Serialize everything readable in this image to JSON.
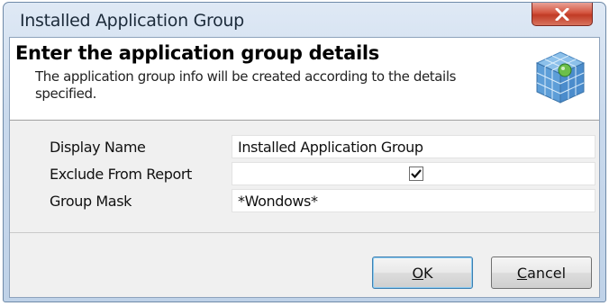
{
  "window": {
    "title": "Installed Application Group"
  },
  "header": {
    "title": "Enter the application group details",
    "description": "The application group info will be created according to the details specified."
  },
  "form": {
    "rows": [
      {
        "label": "Display Name",
        "value": "Installed Application Group"
      },
      {
        "label": "Exclude From Report",
        "checked": true
      },
      {
        "label": "Group Mask",
        "value": "*Wondows*"
      }
    ]
  },
  "buttons": {
    "ok": {
      "mnemonic": "O",
      "rest": "K"
    },
    "cancel": {
      "mnemonic": "C",
      "rest": "ancel"
    }
  },
  "icons": {
    "close": "close-icon",
    "header": "application-cube-icon",
    "check": "checkmark-icon"
  }
}
